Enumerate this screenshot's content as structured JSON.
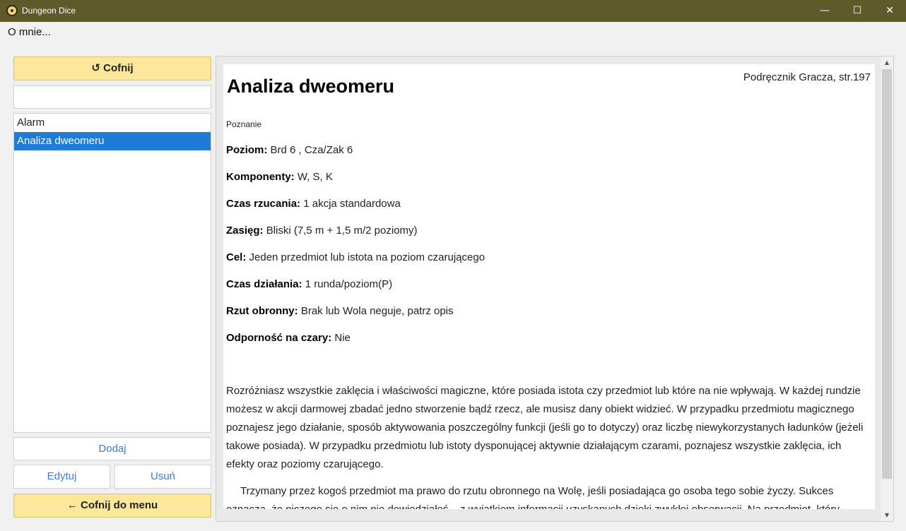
{
  "window": {
    "title": "Dungeon Dice",
    "app_icon": "dice-icon",
    "minimize_glyph": "—",
    "maximize_glyph": "☐",
    "close_glyph": "✕"
  },
  "menu": {
    "about": "O mnie..."
  },
  "sidebar": {
    "back_label": "Cofnij",
    "back_icon_glyph": "↺",
    "search_value": "",
    "items": [
      {
        "label": "Alarm",
        "selected": false
      },
      {
        "label": "Analiza dweomeru",
        "selected": true
      }
    ],
    "add_label": "Dodaj",
    "edit_label": "Edytuj",
    "delete_label": "Usuń",
    "back_to_menu_label": "Cofnij do menu",
    "back_to_menu_icon_glyph": "←"
  },
  "spell": {
    "name": "Analiza dweomeru",
    "source": "Podręcznik Gracza, str.197",
    "school": "Poznanie",
    "stats": [
      {
        "label": "Poziom:",
        "value": "Brd 6 , Cza/Zak 6"
      },
      {
        "label": "Komponenty:",
        "value": "W, S, K"
      },
      {
        "label": "Czas rzucania:",
        "value": "1 akcja standardowa"
      },
      {
        "label": "Zasięg:",
        "value": "Bliski (7,5 m + 1,5 m/2 poziomy)"
      },
      {
        "label": "Cel:",
        "value": "Jeden przedmiot lub istota na poziom czarującego"
      },
      {
        "label": "Czas działania:",
        "value": "1 runda/poziom(P)"
      },
      {
        "label": "Rzut obronny:",
        "value": "Brak lub Wola neguje, patrz opis"
      },
      {
        "label": "Odporność na czary:",
        "value": "Nie"
      }
    ],
    "description": [
      "Rozróżniasz wszystkie zaklęcia i właściwości magiczne, które posiada istota czy przedmiot lub które na nie wpływają. W każdej rundzie możesz w akcji darmowej zbadać jedno stworzenie bądź rzecz, ale musisz dany obiekt widzieć. W przypadku przedmiotu magicznego poznajesz jego działanie, sposób aktywowania poszczególny funkcji (jeśli go to dotyczy) oraz liczbę niewykorzystanych ładunków (jeżeli takowe posiada). W przypadku przedmiotu lub istoty dysponującej aktywnie działającym czarami, poznajesz wszystkie zaklęcia, ich efekty oraz poziomy czarującego.",
      "Trzymany przez kogoś przedmiot ma prawo do rzutu obronnego na Wolę, jeśli posiadająca go osoba tego sobie życzy. Sukces oznacza, że niczego się o nim nie dowiedziałeś – z wyjątkiem informacji uzyskanych dzięki zwykłej obserwacji. Na przedmiot, który"
    ]
  }
}
